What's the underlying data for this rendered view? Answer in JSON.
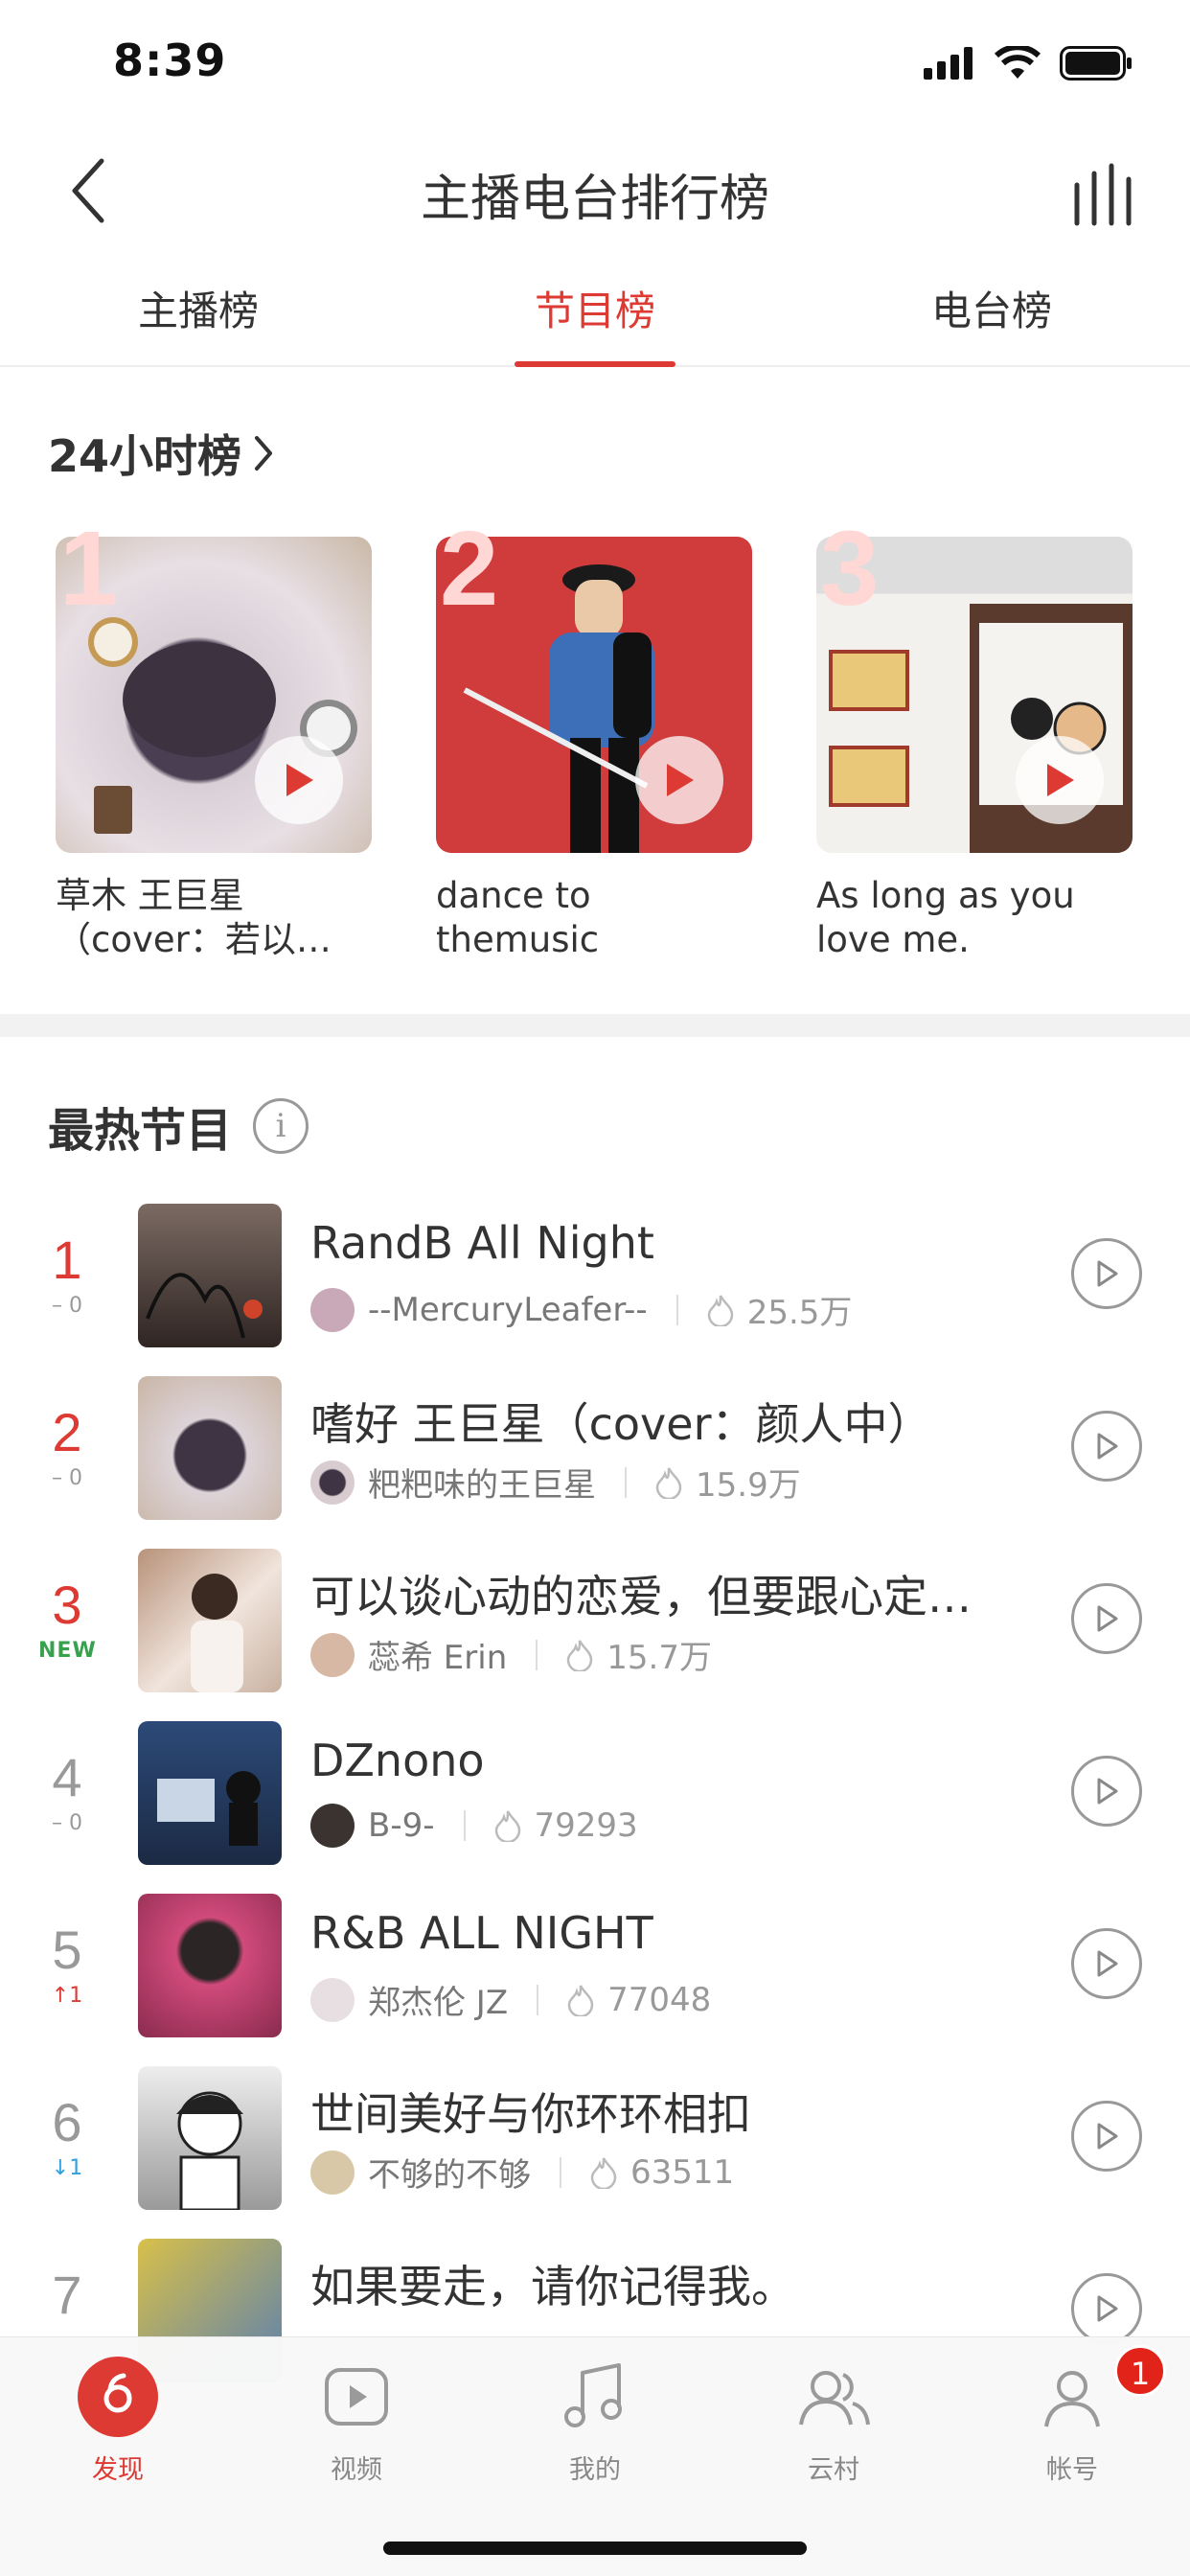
{
  "status": {
    "time": "8:39"
  },
  "nav": {
    "title": "主播电台排行榜"
  },
  "tabs": [
    {
      "label": "主播榜"
    },
    {
      "label": "节目榜"
    },
    {
      "label": "电台榜"
    }
  ],
  "section24": {
    "label": "24小时榜"
  },
  "top3": [
    {
      "rank": "1",
      "title": "草木 王巨星（cover：若以…"
    },
    {
      "rank": "2",
      "title": "dance to themusic"
    },
    {
      "rank": "3",
      "title": "As long as you love me."
    }
  ],
  "hot": {
    "title": "最热节目",
    "info_icon": "i",
    "rows": [
      {
        "rank": "1",
        "delta": "– 0",
        "title": "RandB All Night",
        "author": "--MercuryLeafer--",
        "heat": "25.5万"
      },
      {
        "rank": "2",
        "delta": "– 0",
        "title": "嗜好 王巨星（cover：颜人中）",
        "author": "粑粑味的王巨星",
        "heat": "15.9万"
      },
      {
        "rank": "3",
        "delta": "NEW",
        "title": "可以谈心动的恋爱，但要跟心定…",
        "author": "蕊希 Erin",
        "heat": "15.7万"
      },
      {
        "rank": "4",
        "delta": "– 0",
        "title": "DZnono",
        "author": "B-9-",
        "heat": "79293"
      },
      {
        "rank": "5",
        "delta": "↑1",
        "title": "R&B ALL NIGHT",
        "author": "郑杰伦 JZ",
        "heat": "77048"
      },
      {
        "rank": "6",
        "delta": "↓1",
        "title": "世间美好与你环环相扣",
        "author": "不够的不够",
        "heat": "63511"
      },
      {
        "rank": "7",
        "delta": "",
        "title": "如果要走，请你记得我。",
        "author": "",
        "heat": ""
      }
    ]
  },
  "tabbar": {
    "items": [
      {
        "label": "发现"
      },
      {
        "label": "视频"
      },
      {
        "label": "我的"
      },
      {
        "label": "云村"
      },
      {
        "label": "帐号"
      }
    ],
    "badge": "1"
  },
  "colors": {
    "accent": "#dd3a33",
    "new": "#37a24e",
    "down": "#2fa0e0"
  }
}
